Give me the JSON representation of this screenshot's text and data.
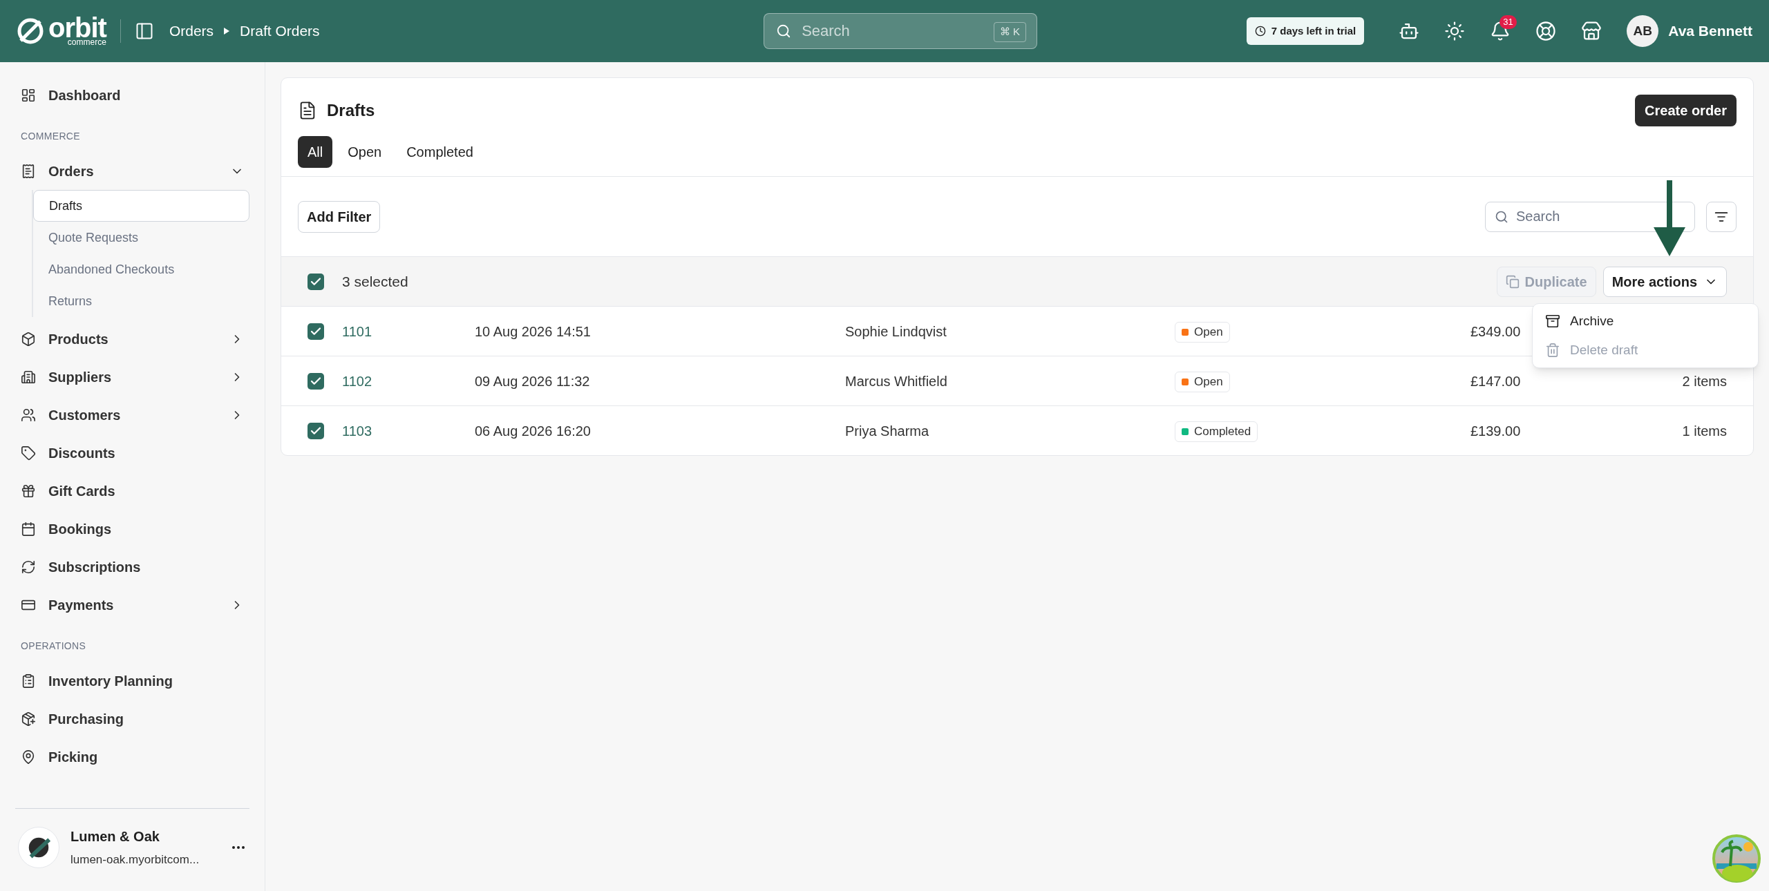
{
  "topbar": {
    "logo": {
      "name": "orbit",
      "sub": "commerce"
    },
    "breadcrumb": [
      "Orders",
      "Draft Orders"
    ],
    "search": {
      "placeholder": "Search",
      "shortcut": "⌘ K"
    },
    "trial": "7 days left in trial",
    "notifications": "31",
    "user": {
      "initials": "AB",
      "name": "Ava Bennett"
    }
  },
  "sidebar": {
    "sections": [
      {
        "items": [
          {
            "label": "Dashboard"
          }
        ]
      },
      {
        "title": "COMMERCE",
        "items": [
          {
            "label": "Orders",
            "expanded": true,
            "children": [
              {
                "label": "Drafts",
                "selected": true
              },
              {
                "label": "Quote Requests",
                "selected": false
              },
              {
                "label": "Abandoned Checkouts",
                "selected": false
              },
              {
                "label": "Returns",
                "selected": false
              }
            ]
          },
          {
            "label": "Products",
            "expanded": false
          },
          {
            "label": "Suppliers",
            "expanded": false
          },
          {
            "label": "Customers",
            "expanded": false
          },
          {
            "label": "Discounts"
          },
          {
            "label": "Gift Cards"
          },
          {
            "label": "Bookings"
          },
          {
            "label": "Subscriptions"
          },
          {
            "label": "Payments",
            "expanded": false
          }
        ]
      },
      {
        "title": "OPERATIONS",
        "items": [
          {
            "label": "Inventory Planning"
          },
          {
            "label": "Purchasing"
          },
          {
            "label": "Picking"
          }
        ]
      }
    ],
    "store": {
      "name": "Lumen & Oak",
      "domain": "lumen-oak.myorbitcom..."
    }
  },
  "page": {
    "title": "Drafts",
    "create_button": "Create order",
    "tabs": [
      {
        "label": "All",
        "selected": true
      },
      {
        "label": "Open",
        "selected": false
      },
      {
        "label": "Completed",
        "selected": false
      }
    ],
    "add_filter": "Add Filter",
    "search": {
      "placeholder": "Search"
    },
    "selection": {
      "checked": true,
      "label": "3 selected",
      "duplicate": {
        "label": "Duplicate",
        "disabled": true
      },
      "more_actions": "More actions"
    },
    "rows": [
      {
        "checked": true,
        "id": "1101",
        "date": "10 Aug 2026 14:51",
        "customer": "Sophie Lindqvist",
        "status": "Open",
        "color": "#f97316",
        "total": "£349.00"
      },
      {
        "checked": true,
        "id": "1102",
        "date": "09 Aug 2026 11:32",
        "customer": "Marcus Whitfield",
        "status": "Open",
        "color": "#f97316",
        "total": "£147.00",
        "items": "2 items"
      },
      {
        "checked": true,
        "id": "1103",
        "date": "06 Aug 2026 16:20",
        "customer": "Priya Sharma",
        "status": "Completed",
        "color": "#10b981",
        "total": "£139.00",
        "items": "1 items"
      }
    ],
    "menu": [
      {
        "label": "Archive",
        "disabled": false
      },
      {
        "label": "Delete draft",
        "disabled": true
      }
    ]
  }
}
